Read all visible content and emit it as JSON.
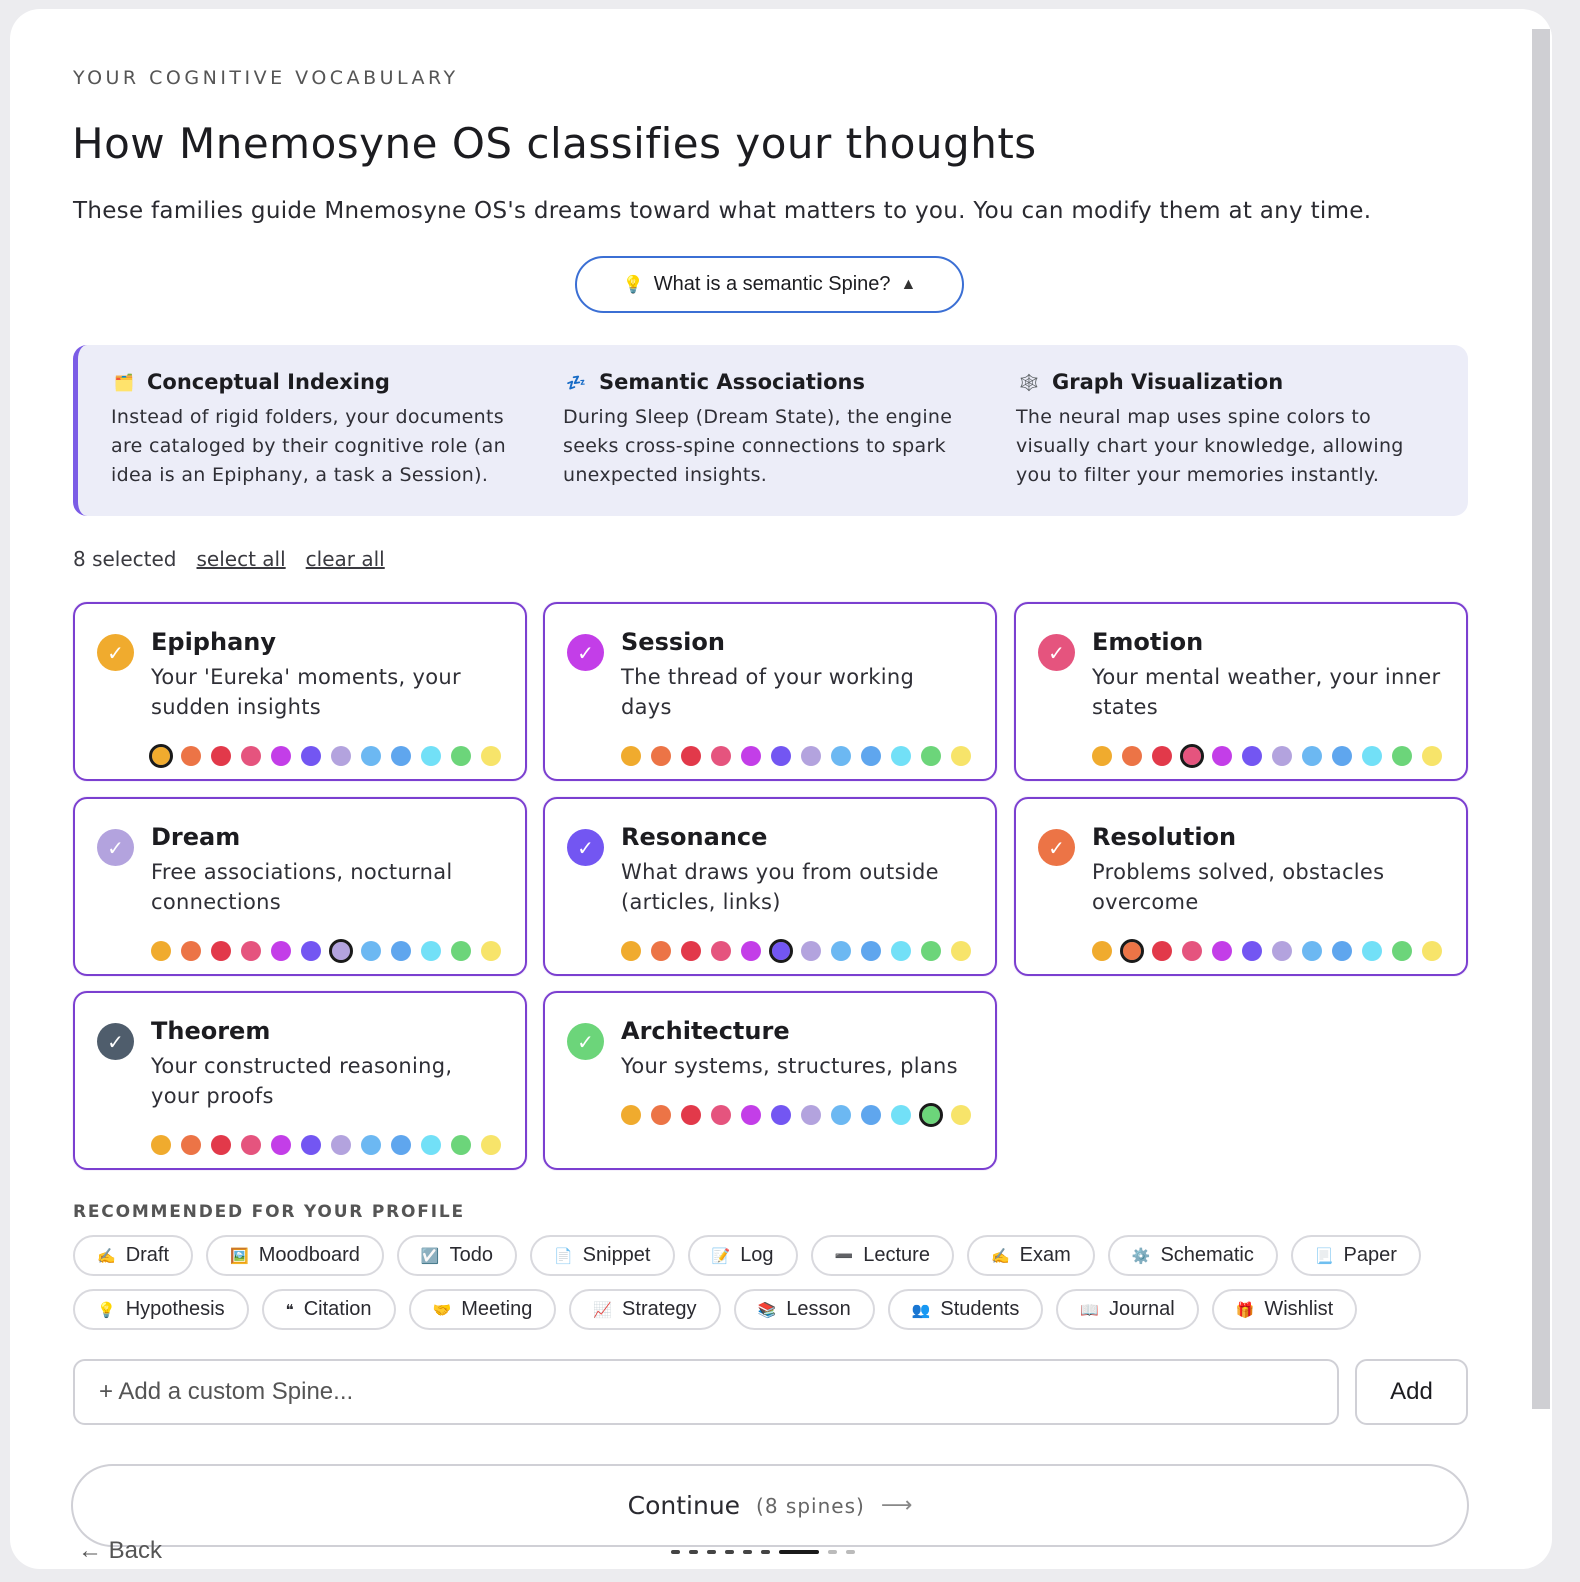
{
  "header": {
    "eyebrow": "YOUR COGNITIVE VOCABULARY",
    "title": "How Mnemosyne OS classifies your thoughts",
    "subtitle": "These families guide Mnemosyne OS's dreams toward what matters to you. You can modify them at any time."
  },
  "info_toggle": {
    "icon": "lightbulb-icon",
    "label": "What is a semantic Spine?",
    "state_glyph": "▲"
  },
  "info_panel": {
    "columns": [
      {
        "icon": "folder-icon",
        "glyph": "🗂️",
        "title": "Conceptual Indexing",
        "text": "Instead of rigid folders, your documents are cataloged by their cognitive role (an idea is an Epiphany, a task a Session)."
      },
      {
        "icon": "sleep-icon",
        "glyph": "💤",
        "title": "Semantic Associations",
        "text": "During Sleep (Dream State), the engine seeks cross-spine connections to spark unexpected insights."
      },
      {
        "icon": "network-icon",
        "glyph": "🕸️",
        "title": "Graph Visualization",
        "text": "The neural map uses spine colors to visually chart your knowledge, allowing you to filter your memories instantly."
      }
    ]
  },
  "selection": {
    "count_label": "8 selected",
    "select_all": "select all",
    "clear_all": "clear all"
  },
  "palette": [
    "#f0ab2e",
    "#ec7446",
    "#e2394a",
    "#e5547e",
    "#c33ee8",
    "#7356f2",
    "#b3a3de",
    "#6cb8f2",
    "#5fa6ee",
    "#72e0f7",
    "#6cd57a",
    "#f7e46a"
  ],
  "spines": [
    {
      "name": "Epiphany",
      "desc": "Your 'Eureka' moments, your sudden insights",
      "color": "#f0ab2e",
      "selected_index": 0
    },
    {
      "name": "Session",
      "desc": "The thread of your working days",
      "color": "#c33ee8",
      "selected_index": -1
    },
    {
      "name": "Emotion",
      "desc": "Your mental weather, your inner states",
      "color": "#e5547e",
      "selected_index": 3
    },
    {
      "name": "Dream",
      "desc": "Free associations, nocturnal connections",
      "color": "#b3a3de",
      "selected_index": 6
    },
    {
      "name": "Resonance",
      "desc": "What draws you from outside (articles, links)",
      "color": "#7356f2",
      "selected_index": 5
    },
    {
      "name": "Resolution",
      "desc": "Problems solved, obstacles overcome",
      "color": "#ec7446",
      "selected_index": 1
    },
    {
      "name": "Theorem",
      "desc": "Your constructed reasoning, your proofs",
      "color": "#4f5d6c",
      "selected_index": -1
    },
    {
      "name": "Architecture",
      "desc": "Your systems, structures, plans",
      "color": "#6cd57a",
      "selected_index": 10
    }
  ],
  "recommended": {
    "title": "RECOMMENDED FOR YOUR PROFILE",
    "row1": [
      {
        "label": "Draft",
        "icon": "pencil-icon",
        "glyph": "✍️"
      },
      {
        "label": "Moodboard",
        "icon": "frame-icon",
        "glyph": "🖼️"
      },
      {
        "label": "Todo",
        "icon": "checkbox-icon",
        "glyph": "☑️"
      },
      {
        "label": "Snippet",
        "icon": "code-file-icon",
        "glyph": "📄"
      },
      {
        "label": "Log",
        "icon": "memo-icon",
        "glyph": "📝"
      },
      {
        "label": "Lecture",
        "icon": "slider-icon",
        "glyph": "➖"
      },
      {
        "label": "Exam",
        "icon": "writing-hand-icon",
        "glyph": "✍️"
      },
      {
        "label": "Schematic",
        "icon": "gear-icon",
        "glyph": "⚙️"
      },
      {
        "label": "Paper",
        "icon": "page-icon",
        "glyph": "📃"
      }
    ],
    "row2": [
      {
        "label": "Hypothesis",
        "icon": "lightbulb-icon",
        "glyph": "💡"
      },
      {
        "label": "Citation",
        "icon": "quote-icon",
        "glyph": "❝"
      },
      {
        "label": "Meeting",
        "icon": "handshake-icon",
        "glyph": "🤝"
      },
      {
        "label": "Strategy",
        "icon": "chart-icon",
        "glyph": "📈"
      },
      {
        "label": "Lesson",
        "icon": "books-icon",
        "glyph": "📚"
      },
      {
        "label": "Students",
        "icon": "people-icon",
        "glyph": "👥"
      },
      {
        "label": "Journal",
        "icon": "book-icon",
        "glyph": "📖"
      },
      {
        "label": "Wishlist",
        "icon": "gift-icon",
        "glyph": "🎁"
      }
    ]
  },
  "custom": {
    "placeholder": "+ Add a custom Spine...",
    "add_label": "Add"
  },
  "footer": {
    "continue_label": "Continue",
    "continue_count": "(8 spines)",
    "continue_arrow": "⟶",
    "back_label": "← Back"
  }
}
